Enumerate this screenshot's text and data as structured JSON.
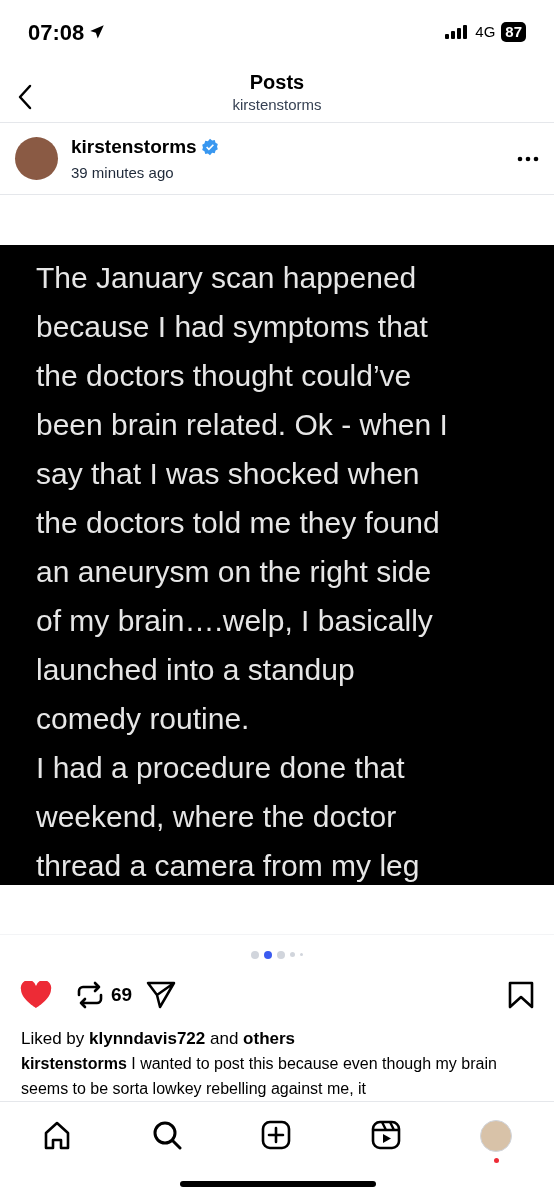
{
  "status_bar": {
    "time": "07:08",
    "network": "4G",
    "battery": "87"
  },
  "header": {
    "title": "Posts",
    "subtitle": "kirstenstorms"
  },
  "post": {
    "username": "kirstenstorms",
    "verified": true,
    "time": "39 minutes ago",
    "slide_lines": [
      "The January scan happened",
      "because I had symptoms that",
      "the doctors thought could’ve",
      "been brain related. Ok - when I",
      "say that I was shocked when",
      "the doctors told me they found",
      "an aneurysm on the right side",
      "of my brain….welp, I basically",
      "launched into a standup",
      "comedy routine.",
      "I had a procedure done that",
      "weekend, where the doctor",
      "thread a camera from my leg"
    ],
    "carousel_dots": [
      {
        "selected": false
      },
      {
        "selected": true
      },
      {
        "selected": false
      },
      {
        "selected": false
      },
      {
        "selected": false
      }
    ],
    "liked": true,
    "repost_count": "69",
    "saved": false,
    "liked_by": "Liked by **klynndavis722** and **others**",
    "caption": "**kirstenstorms** I wanted to post this because even though my brain seems to be sorta lowkey rebelling against me, it"
  },
  "nav": {
    "items": [
      {
        "kind": "home"
      },
      {
        "kind": "search"
      },
      {
        "kind": "create"
      },
      {
        "kind": "reels"
      },
      {
        "kind": "profile",
        "notification": true
      }
    ]
  }
}
